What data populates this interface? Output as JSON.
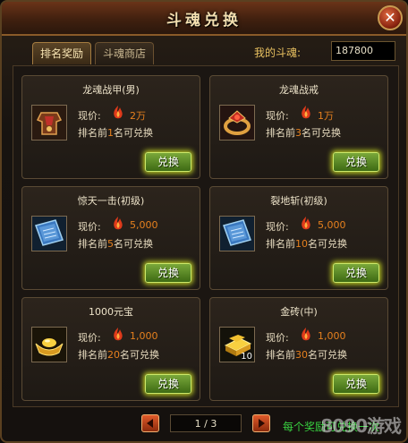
{
  "window": {
    "title": "斗魂兑换",
    "close_label": "✕"
  },
  "tabs": [
    {
      "label": "排名奖励",
      "active": true
    },
    {
      "label": "斗魂商店",
      "active": false
    }
  ],
  "souls": {
    "label": "我的斗魂:",
    "value": "187800"
  },
  "price_label": "现价:",
  "rank_prefix": "排名前",
  "rank_suffix": "名可兑换",
  "button_label": "兑换",
  "items": [
    {
      "name": "龙魂战甲(男)",
      "price": "2万",
      "rank": "1",
      "icon": "armor-icon",
      "qty": ""
    },
    {
      "name": "龙魂战戒",
      "price": "1万",
      "rank": "3",
      "icon": "ring-icon",
      "qty": ""
    },
    {
      "name": "惊天一击(初级)",
      "price": "5,000",
      "rank": "5",
      "icon": "skill-book-icon",
      "qty": ""
    },
    {
      "name": "裂地斩(初级)",
      "price": "5,000",
      "rank": "10",
      "icon": "skill-book-icon",
      "qty": ""
    },
    {
      "name": "1000元宝",
      "price": "1,000",
      "rank": "20",
      "icon": "gold-ingot-icon",
      "qty": ""
    },
    {
      "name": "金砖(中)",
      "price": "1,000",
      "rank": "30",
      "icon": "gold-brick-icon",
      "qty": "10"
    }
  ],
  "pager": {
    "text": "1 / 3"
  },
  "footer_note": "每个奖励可兑换一次",
  "watermark": "8090游戏",
  "colors": {
    "accent_orange": "#e6801e",
    "button_green": "#5d8a24",
    "button_glow": "#dcf028"
  }
}
